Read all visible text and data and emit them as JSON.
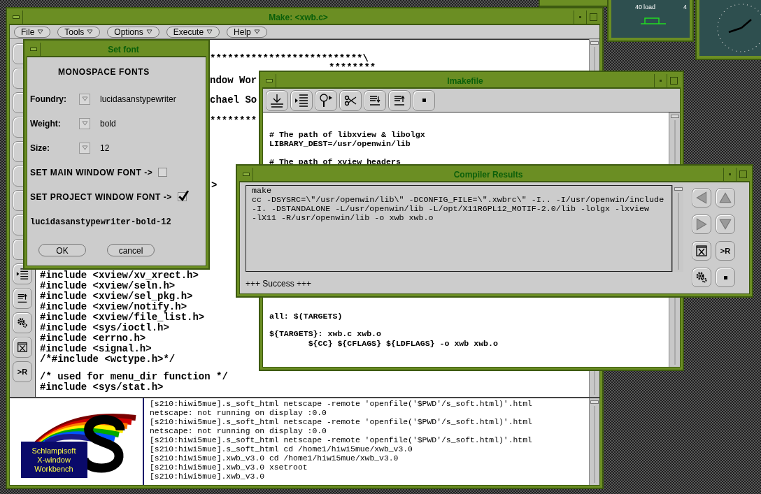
{
  "main_window": {
    "title": "Make: <xwb.c>",
    "menus": [
      "File",
      "Tools",
      "Options",
      "Execute",
      "Help"
    ],
    "run_label": ">R",
    "editor_lines": [
      "**************************\\",
      "********",
      "ndow Wor",
      "chael So",
      "********",
      ">",
      "#include <xview/xv_xrect.h>",
      "#include <xview/seln.h>",
      "#include <xview/sel_pkg.h>",
      "#include <xview/notify.h>",
      "#include <xview/file_list.h>",
      "#include <sys/ioctl.h>",
      "#include <errno.h>",
      "#include <signal.h>",
      "/*#include <wctype.h>*/",
      "/* used for menu_dir function */",
      "#include <sys/stat.h>"
    ],
    "logo_lines": [
      "Schlampisoft",
      "X-window",
      "Workbench"
    ],
    "terminal_lines": [
      "[s210:hiwi5mue].s_soft_html netscape -remote 'openfile('$PWD'/s_soft.html)'.html",
      "netscape: not running on display :0.0",
      "[s210:hiwi5mue].s_soft_html netscape -remote 'openfile('$PWD'/s_soft.html)'.html",
      "netscape: not running on display :0.0",
      "[s210:hiwi5mue].s_soft_html netscape -remote 'openfile('$PWD'/s_soft.html)'.html",
      "[s210:hiwi5mue].s_soft_html cd /home1/hiwi5mue/xwb_v3.0",
      "[s210:hiwi5mue].xwb_v3.0 cd /home1/hiwi5mue/xwb_v3.0",
      "[s210:hiwi5mue].xwb_v3.0 xsetroot",
      "[s210:hiwi5mue].xwb_v3.0"
    ]
  },
  "set_font": {
    "title": "Set font",
    "heading": "MONOSPACE FONTS",
    "fields": [
      {
        "label": "Foundry:",
        "value": "lucidasanstypewriter"
      },
      {
        "label": "Weight:",
        "value": "bold"
      },
      {
        "label": "Size:",
        "value": "12"
      }
    ],
    "checks": [
      {
        "label": "SET MAIN WINDOW FONT ->",
        "checked": false
      },
      {
        "label": "SET PROJECT WINDOW FONT ->",
        "checked": true
      }
    ],
    "preview": "lucidasanstypewriter-bold-12",
    "buttons": [
      "OK",
      "cancel"
    ]
  },
  "imakefile": {
    "title": "Imakefile",
    "lines": [
      "# The path of libxview & libolgx",
      "LIBRARY_DEST=/usr/openwin/lib",
      "# The path of xview headers",
      "all: $(TARGETS)",
      "${TARGETS}: xwb.c xwb.o",
      "        ${CC} ${CFLAGS} ${LDFLAGS} -o xwb xwb.o"
    ]
  },
  "compiler_results": {
    "title": "Compiler Results",
    "output": [
      "make",
      "cc -DSYSRC=\\\"/usr/openwin/lib\\\" -DCONFIG_FILE=\\\".xwbrc\\\" -I.. -I/usr/openwin/include",
      "-I. -DSTANDALONE -L/usr/openwin/lib -L/opt/X11R6PL12_MOTIF-2.0/lib -lolgx -lxview",
      "-lX11 -R/usr/openwin/lib -o xwb xwb.o"
    ],
    "status": "+++ Success +++",
    "run_label": ">R"
  },
  "perfmeter": {
    "labels": [
      "40",
      "load",
      "4"
    ]
  }
}
